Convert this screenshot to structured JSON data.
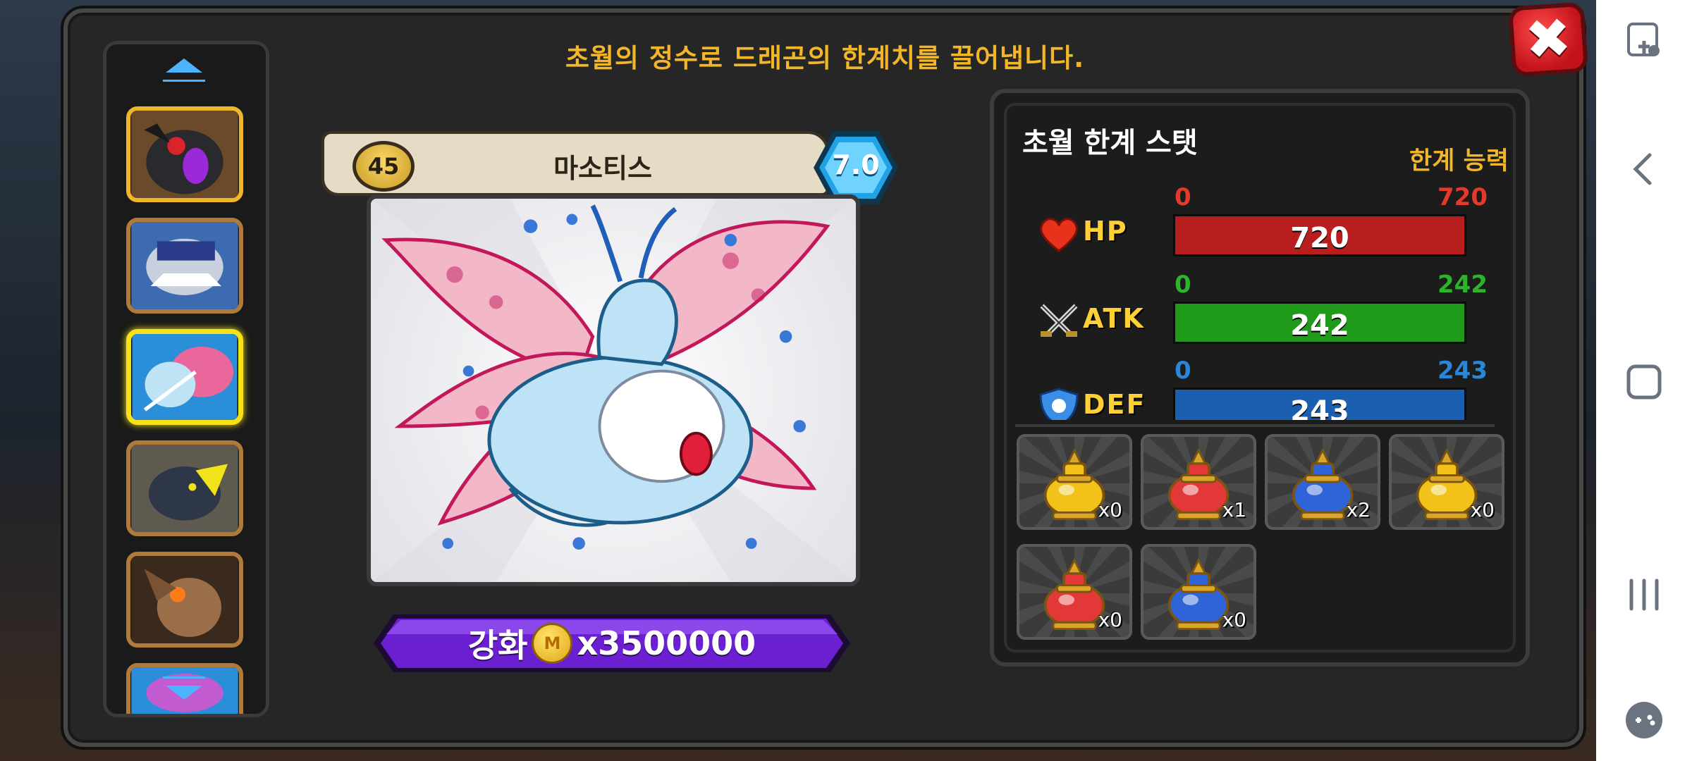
{
  "dialog": {
    "subtitle": "초월의 정수로 드래곤의 한계치를 끌어냅니다.",
    "close_label": "✖"
  },
  "dragon": {
    "level": "45",
    "name": "마소티스",
    "grade": "7.0"
  },
  "enhance": {
    "label": "강화",
    "coin_letter": "M",
    "cost": "x3500000"
  },
  "stats_panel": {
    "title": "초월 한계 스탯",
    "limit_label": "한계 능력",
    "stats": [
      {
        "key": "hp",
        "label": "HP",
        "min": "0",
        "max": "720",
        "value": "720",
        "fill_fraction": 1.0,
        "color": "#b81e1e",
        "text_color": "#e23b2b"
      },
      {
        "key": "atk",
        "label": "ATK",
        "min": "0",
        "max": "242",
        "value": "242",
        "fill_fraction": 1.0,
        "color": "#1f9a1a",
        "text_color": "#2bb52a"
      },
      {
        "key": "def",
        "label": "DEF",
        "min": "0",
        "max": "243",
        "value": "243",
        "fill_fraction": 1.0,
        "color": "#1c5fb0",
        "text_color": "#2a86d8"
      }
    ]
  },
  "items": [
    {
      "name": "yellow-essence-flask",
      "color": "#f2c21a",
      "count": "x0"
    },
    {
      "name": "red-essence-flask",
      "color": "#e23838",
      "count": "x1"
    },
    {
      "name": "blue-essence-flask",
      "color": "#2f63d8",
      "count": "x2"
    },
    {
      "name": "large-yellow-essence-flask",
      "color": "#f2c21a",
      "count": "x0"
    },
    {
      "name": "large-red-essence-flask",
      "color": "#e23838",
      "count": "x0"
    },
    {
      "name": "large-blue-essence-flask",
      "color": "#2f63d8",
      "count": "x0"
    }
  ],
  "thumbnails": [
    {
      "name": "black-red-dragon",
      "border": "#f0b62a",
      "bg": "#6b4a2a"
    },
    {
      "name": "armored-blue-dragon",
      "border": "#b07a3a",
      "bg": "#3d6bb0"
    },
    {
      "name": "pink-fairy-dragon",
      "border": "#f7e21a",
      "bg": "#2a8fd8"
    },
    {
      "name": "dark-rock-dragon",
      "border": "#b07a3a",
      "bg": "#5f5a50"
    },
    {
      "name": "horned-brown-dragon",
      "border": "#b07a3a",
      "bg": "#6e4a2e"
    },
    {
      "name": "partial-dragon",
      "border": "#b07a3a",
      "bg": "#2a8fd8"
    }
  ],
  "colors": {
    "accent_gold": "#f2b628",
    "panel": "#262626",
    "enhance_purple": "#6a1fd0"
  },
  "nav": {
    "icons": [
      "gamepad-touch-icon",
      "back-icon",
      "home-icon",
      "recents-icon",
      "game-tools-icon"
    ]
  }
}
